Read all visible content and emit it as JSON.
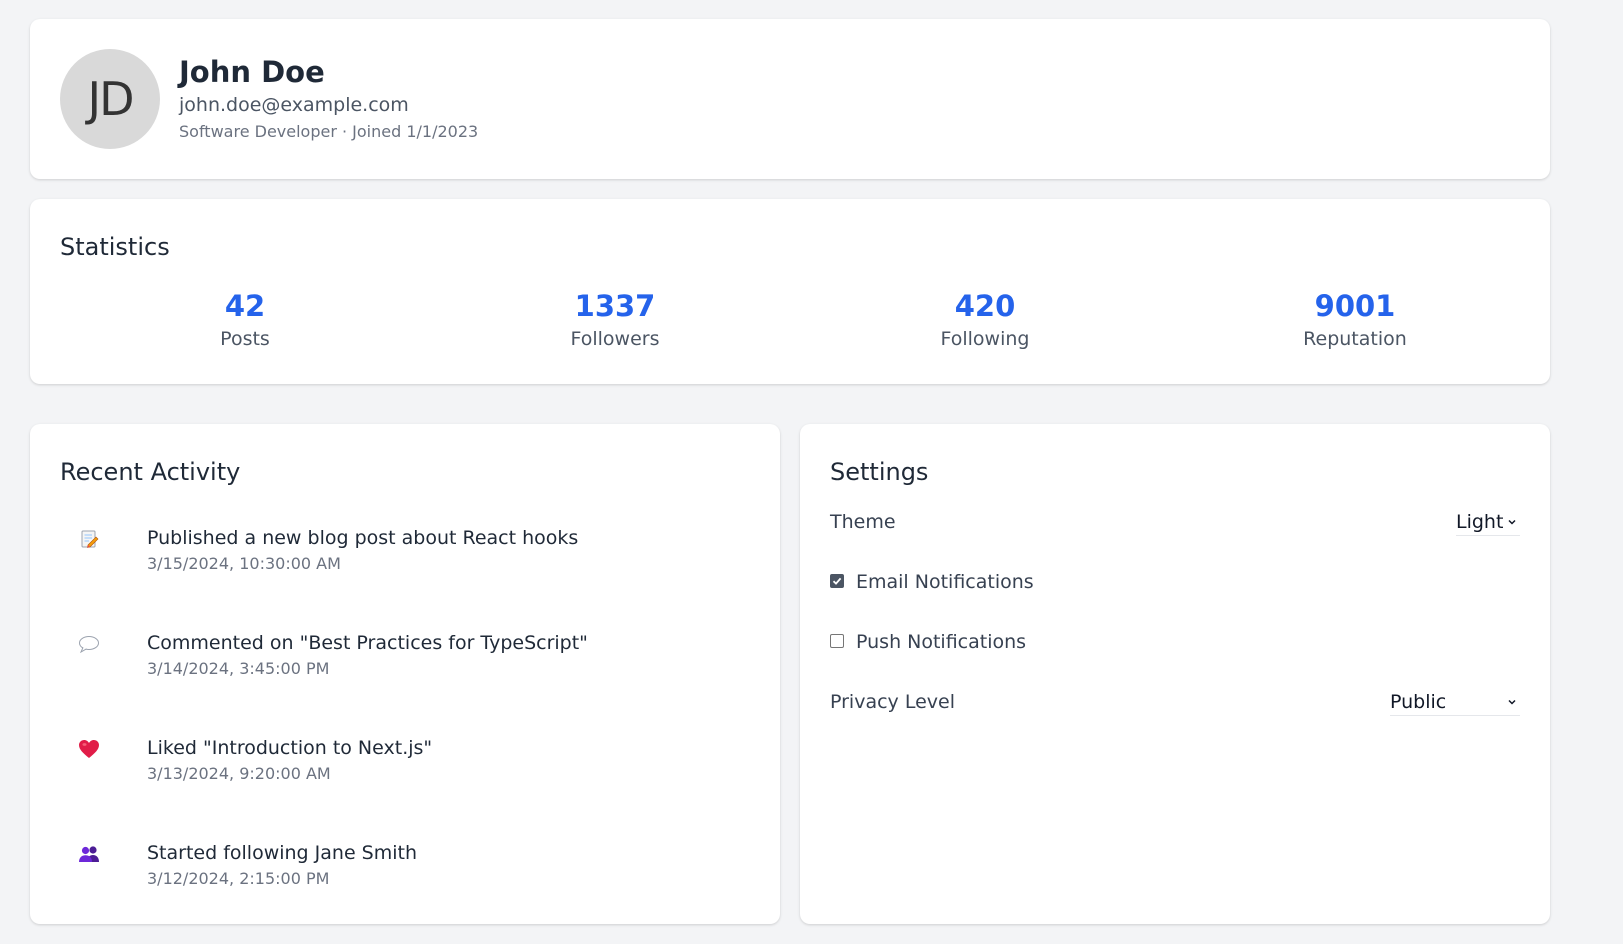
{
  "profile": {
    "initials": "JD",
    "name": "John Doe",
    "email": "john.doe@example.com",
    "meta": "Software Developer · Joined 1/1/2023"
  },
  "statistics": {
    "title": "Statistics",
    "items": [
      {
        "value": "42",
        "label": "Posts"
      },
      {
        "value": "1337",
        "label": "Followers"
      },
      {
        "value": "420",
        "label": "Following"
      },
      {
        "value": "9001",
        "label": "Reputation"
      }
    ]
  },
  "activity": {
    "title": "Recent Activity",
    "items": [
      {
        "icon": "memo-icon",
        "text": "Published a new blog post about React hooks",
        "time": "3/15/2024, 10:30:00 AM"
      },
      {
        "icon": "speech-bubble-icon",
        "text": "Commented on \"Best Practices for TypeScript\"",
        "time": "3/14/2024, 3:45:00 PM"
      },
      {
        "icon": "heart-icon",
        "text": "Liked \"Introduction to Next.js\"",
        "time": "3/13/2024, 9:20:00 AM"
      },
      {
        "icon": "people-icon",
        "text": "Started following Jane Smith",
        "time": "3/12/2024, 2:15:00 PM"
      }
    ]
  },
  "settings": {
    "title": "Settings",
    "theme_label": "Theme",
    "theme_value": "Light",
    "email_notifications_label": "Email Notifications",
    "email_notifications_checked": true,
    "push_notifications_label": "Push Notifications",
    "push_notifications_checked": false,
    "privacy_label": "Privacy Level",
    "privacy_value": "Public"
  },
  "colors": {
    "accent": "#2563eb",
    "background": "#f3f4f6",
    "heart": "#e11d48"
  }
}
